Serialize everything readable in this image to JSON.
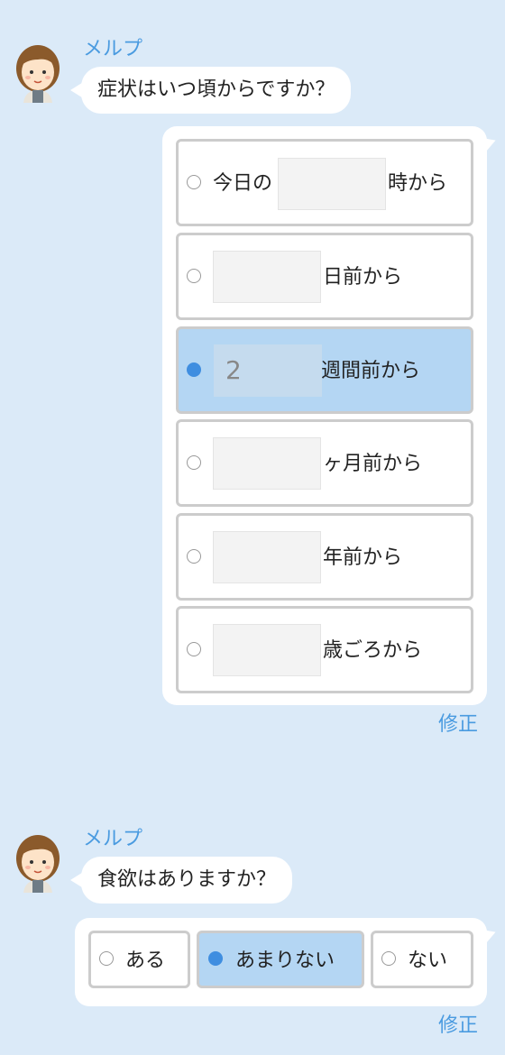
{
  "messages": [
    {
      "sender": "メルプ",
      "question": "症状はいつ頃からですか？",
      "options": [
        {
          "prefix": "今日の",
          "value": "",
          "suffix": "時から",
          "selected": false
        },
        {
          "prefix": "",
          "value": "",
          "suffix": "日前から",
          "selected": false
        },
        {
          "prefix": "",
          "value": "2",
          "suffix": "週間前から",
          "selected": true
        },
        {
          "prefix": "",
          "value": "",
          "suffix": "ヶ月前から",
          "selected": false
        },
        {
          "prefix": "",
          "value": "",
          "suffix": "年前から",
          "selected": false
        },
        {
          "prefix": "",
          "value": "",
          "suffix": "歳ごろから",
          "selected": false
        }
      ],
      "edit_label": "修正"
    },
    {
      "sender": "メルプ",
      "question": "食欲はありますか？",
      "options": [
        {
          "label": "ある",
          "selected": false
        },
        {
          "label": "あまりない",
          "selected": true
        },
        {
          "label": "ない",
          "selected": false
        }
      ],
      "edit_label": "修正"
    }
  ],
  "colors": {
    "background": "#dbeaf8",
    "accent": "#4a9be0",
    "selected_bg": "#b4d6f3",
    "radio_on": "#3f8ee0"
  }
}
